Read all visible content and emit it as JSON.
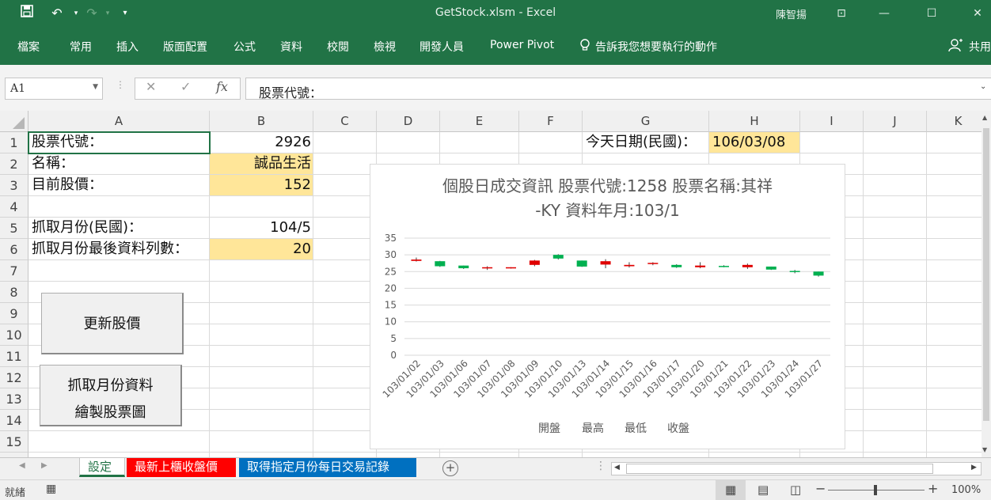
{
  "window": {
    "title": "GetStock.xlsm  -  Excel",
    "user": "陳智揚",
    "share": "共用"
  },
  "ribbon": {
    "tabs": [
      "檔案",
      "常用",
      "插入",
      "版面配置",
      "公式",
      "資料",
      "校閱",
      "檢視",
      "開發人員",
      "Power Pivot"
    ],
    "tell_me": "告訴我您想要執行的動作"
  },
  "formula_bar": {
    "name_box": "A1",
    "formula": "股票代號："
  },
  "columns": [
    "A",
    "B",
    "C",
    "D",
    "E",
    "F",
    "G",
    "H",
    "I",
    "J",
    "K"
  ],
  "rows": [
    "1",
    "2",
    "3",
    "4",
    "5",
    "6",
    "7",
    "8",
    "9",
    "10",
    "11",
    "12",
    "13",
    "14",
    "15"
  ],
  "cells": {
    "A1": "股票代號：",
    "B1": "2926",
    "A2": "名稱：",
    "B2": "誠品生活",
    "A3": "目前股價：",
    "B3": "152",
    "A5": "抓取月份(民國)：",
    "B5": "104/5",
    "A6": "抓取月份最後資料列數：",
    "B6": "20",
    "G1": "今天日期(民國)：",
    "H1": "106/03/08"
  },
  "buttons": {
    "update_price": "更新股價",
    "fetch_line1": "抓取月份資料",
    "fetch_line2": "繪製股票圖"
  },
  "chart_data": {
    "type": "candlestick",
    "title": "個股日成交資訊 股票代號:1258 股票名稱:其祥-KY 資料年月:103/1",
    "title_line1": "個股日成交資訊 股票代號:1258 股票名稱:其祥",
    "title_line2": "-KY 資料年月:103/1",
    "ylim": [
      0,
      35
    ],
    "yticks": [
      0,
      5,
      10,
      15,
      20,
      25,
      30,
      35
    ],
    "grid": true,
    "up_color": "#e00000",
    "down_color": "#00b050",
    "categories": [
      "103/01/02",
      "103/01/03",
      "103/01/06",
      "103/01/07",
      "103/01/08",
      "103/01/09",
      "103/01/10",
      "103/01/13",
      "103/01/14",
      "103/01/15",
      "103/01/16",
      "103/01/17",
      "103/01/20",
      "103/01/21",
      "103/01/22",
      "103/01/23",
      "103/01/24",
      "103/01/27"
    ],
    "open": [
      28.2,
      28.1,
      26.8,
      26.0,
      26.0,
      27.0,
      30.0,
      28.3,
      27.1,
      26.6,
      27.3,
      27.0,
      26.3,
      26.7,
      26.3,
      26.5,
      25.2,
      25.0
    ],
    "high": [
      29.2,
      28.2,
      26.8,
      26.6,
      26.3,
      28.5,
      30.2,
      28.3,
      28.7,
      27.8,
      27.8,
      27.2,
      27.8,
      26.9,
      27.4,
      26.5,
      25.5,
      25.0
    ],
    "low": [
      28.0,
      26.4,
      25.8,
      25.5,
      25.9,
      26.6,
      28.6,
      26.4,
      26.0,
      26.2,
      26.9,
      26.1,
      26.0,
      26.3,
      25.8,
      25.5,
      24.5,
      23.5
    ],
    "close": [
      28.6,
      26.6,
      26.0,
      26.3,
      26.3,
      28.3,
      28.9,
      26.5,
      28.1,
      27.0,
      27.6,
      26.3,
      26.8,
      26.4,
      27.0,
      25.6,
      25.0,
      23.8
    ],
    "legend": [
      "開盤",
      "最高",
      "最低",
      "收盤"
    ],
    "legend_position": "bottom"
  },
  "sheet_tabs": [
    {
      "label": "設定",
      "active": true,
      "color": "#ffffff",
      "text": "#217346"
    },
    {
      "label": "最新上櫃收盤價",
      "active": false,
      "color": "#ff0000",
      "text": "#ffffff"
    },
    {
      "label": "取得指定月份每日交易記錄",
      "active": false,
      "color": "#0070c0",
      "text": "#ffffff"
    }
  ],
  "status": {
    "ready": "就緒",
    "zoom": "100%"
  }
}
